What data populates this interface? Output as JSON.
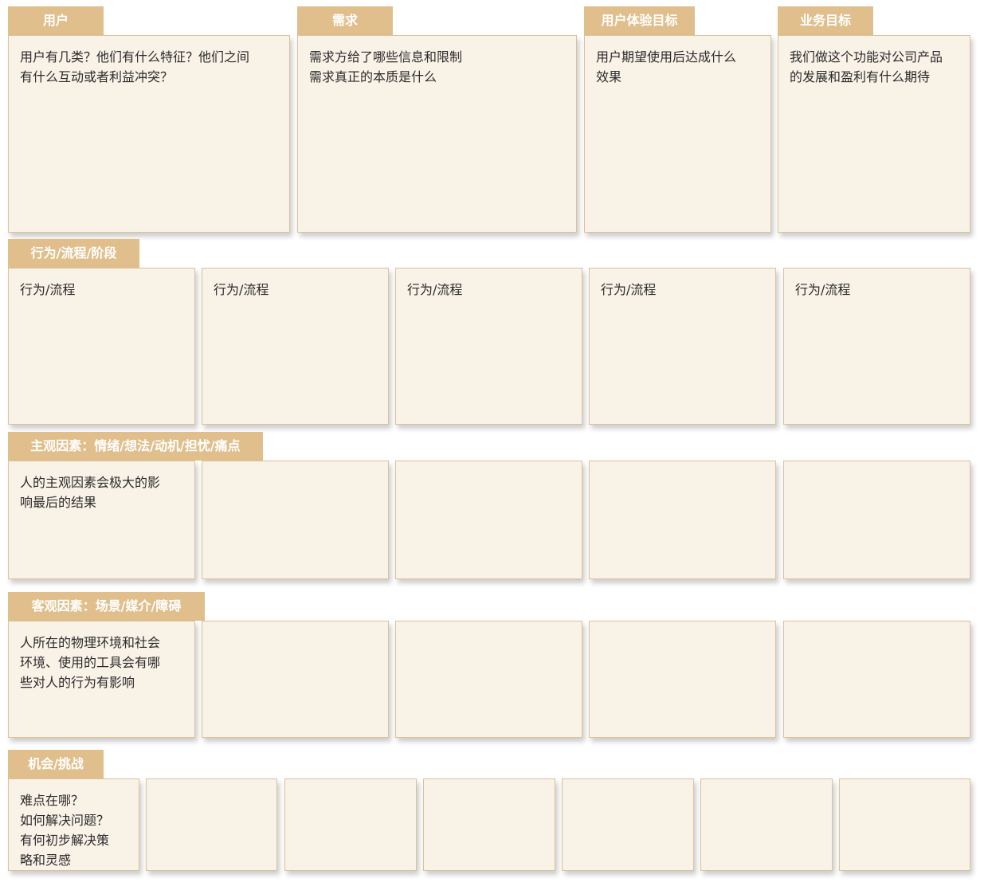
{
  "sections": {
    "users": {
      "tab": "用户",
      "card": "用户有几类？他们有什么特征？他们之间\n有什么互动或者利益冲突？"
    },
    "needs": {
      "tab": "需求",
      "card": "需求方给了哪些信息和限制\n需求真正的本质是什么"
    },
    "ux_goals": {
      "tab": "用户体验目标",
      "card": "用户期望使用后达成什么\n效果"
    },
    "business_goals": {
      "tab": "业务目标",
      "card": "我们做这个功能对公司产品\n的发展和盈利有什么期待"
    },
    "behavior": {
      "tab": "行为/流程/阶段",
      "cards": [
        "行为/流程",
        "行为/流程",
        "行为/流程",
        "行为/流程",
        "行为/流程"
      ]
    },
    "subjective": {
      "tab": "主观因素：情绪/想法/动机/担忧/痛点",
      "cards": [
        "人的主观因素会极大的影\n响最后的结果",
        "",
        "",
        "",
        ""
      ]
    },
    "objective": {
      "tab": "客观因素：场景/媒介/障碍",
      "cards": [
        "人所在的物理环境和社会\n环境、使用的工具会有哪\n些对人的行为有影响",
        "",
        "",
        "",
        ""
      ]
    },
    "opportunities": {
      "tab": "机会/挑战",
      "cards": [
        "难点在哪？\n如何解决问题？\n有何初步解决策\n略和灵感",
        "",
        "",
        "",
        "",
        "",
        ""
      ]
    }
  },
  "colors": {
    "tab_background": "#e0bf8c",
    "tab_text": "#ffffff",
    "card_background": "#f8f2e7",
    "card_border": "#dcc29a"
  }
}
